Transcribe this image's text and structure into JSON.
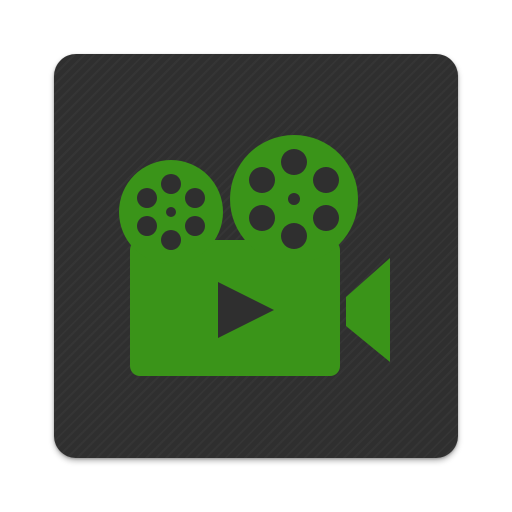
{
  "app_icon": {
    "icon": "video-camera-icon",
    "background_color": "#2f2f2f",
    "accent_color": "#3a9419",
    "hole_color": "#2f2f2f"
  }
}
